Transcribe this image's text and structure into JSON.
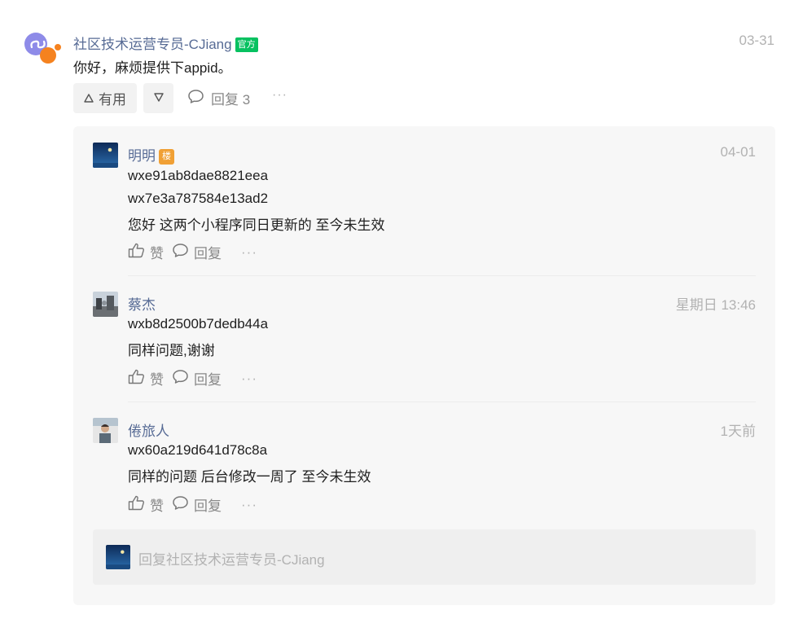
{
  "post": {
    "author": "社区技术运营专员-CJiang",
    "badge": "官方",
    "date": "03-31",
    "content": "你好，麻烦提供下appid。",
    "useful_label": "有用",
    "reply_label": "回复 3",
    "more": "···"
  },
  "replies": [
    {
      "name": "明明",
      "badge": "楼",
      "date": "04-01",
      "lines": [
        "wxe91ab8dae8821eea",
        "wx7e3a787584e13ad2",
        "您好 这两个小程序同日更新的 至今未生效"
      ],
      "like_label": "赞",
      "reply_label": "回复",
      "more": "···"
    },
    {
      "name": "蔡杰",
      "date": "星期日 13:46",
      "lines": [
        "wxb8d2500b7dedb44a",
        "同样问题,谢谢"
      ],
      "like_label": "赞",
      "reply_label": "回复",
      "more": "···"
    },
    {
      "name": "倦旅人",
      "date": "1天前",
      "lines": [
        "wx60a219d641d78c8a",
        "同样的问题 后台修改一周了 至今未生效"
      ],
      "like_label": "赞",
      "reply_label": "回复",
      "more": "···"
    }
  ],
  "compose": {
    "placeholder": "回复社区技术运营专员-CJiang"
  },
  "colors": {
    "name_link": "#576b95",
    "official_badge": "#07c160",
    "floor_badge": "#f0a035",
    "muted": "#b2b2b2",
    "reply_bg": "#f7f7f7"
  },
  "icons": [
    "miniprogram-logo-icon",
    "thumb-up-triangle-icon",
    "thumb-down-triangle-icon",
    "comment-bubble-icon",
    "like-thumb-icon",
    "more-dots-icon"
  ]
}
